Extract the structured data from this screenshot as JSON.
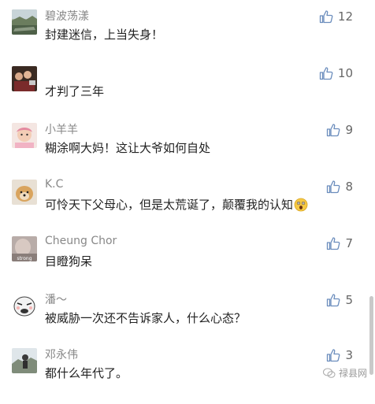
{
  "comments": [
    {
      "user": "碧波荡漾",
      "text": "封建迷信，上当失身！",
      "likes": "12",
      "avatar": "landscape-avatar"
    },
    {
      "user": "",
      "text": "才判了三年",
      "likes": "10",
      "avatar": "group-photo-avatar"
    },
    {
      "user": "小羊羊",
      "text": "糊涂啊大妈！这让大爷如何自处",
      "likes": "9",
      "avatar": "baby-avatar"
    },
    {
      "user": "K.C",
      "text": "可怜天下父母心，但是太荒诞了，颠覆我的认知",
      "likes": "8",
      "avatar": "dog-avatar"
    },
    {
      "user": "Cheung Chor",
      "text": "目瞪狗呆",
      "likes": "7",
      "avatar": "strong-avatar"
    },
    {
      "user": "潘～",
      "text": "被威胁一次还不告诉家人，什么心态？",
      "likes": "5",
      "avatar": "cartoon-avatar"
    },
    {
      "user": "邓永伟",
      "text": "都什么年代了。",
      "likes": "3",
      "avatar": "outdoor-avatar"
    }
  ],
  "watermark": {
    "text": "禄县网"
  },
  "colors": {
    "username": "#888888",
    "text": "#222222",
    "like": "#6b8dbd"
  }
}
